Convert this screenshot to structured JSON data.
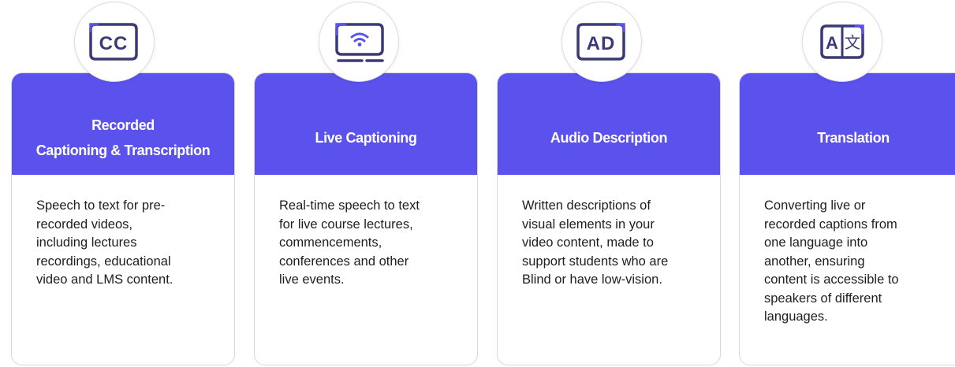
{
  "services": [
    {
      "icon": "closed-captions-icon",
      "icon_text": "CC",
      "title": "Recorded\nCaptioning & Transcription",
      "description": "Speech to text for pre-\nrecorded videos,\nincluding lectures\nrecordings, educational\nvideo and LMS content."
    },
    {
      "icon": "live-broadcast-icon",
      "title": "Live Captioning",
      "description": "Real-time speech to text\nfor live course lectures,\ncommencements,\nconferences and other\nlive events."
    },
    {
      "icon": "audio-description-icon",
      "icon_text": "AD",
      "title": "Audio Description",
      "description": "Written descriptions of\nvisual elements in your\nvideo content, made to\nsupport students who are\nBlind or have low-vision."
    },
    {
      "icon": "translation-icon",
      "icon_text_latin": "A",
      "icon_text_cjk": "文",
      "title": "Translation",
      "description": " Converting live or\nrecorded captions from\none language into\nanother, ensuring\ncontent is accessible to\nspeakers of different\nlanguages."
    }
  ],
  "colors": {
    "header": "#5b52ee",
    "icon_stroke": "#3a3a78",
    "icon_accent": "#5b52ee",
    "text": "#1e1e1e"
  }
}
